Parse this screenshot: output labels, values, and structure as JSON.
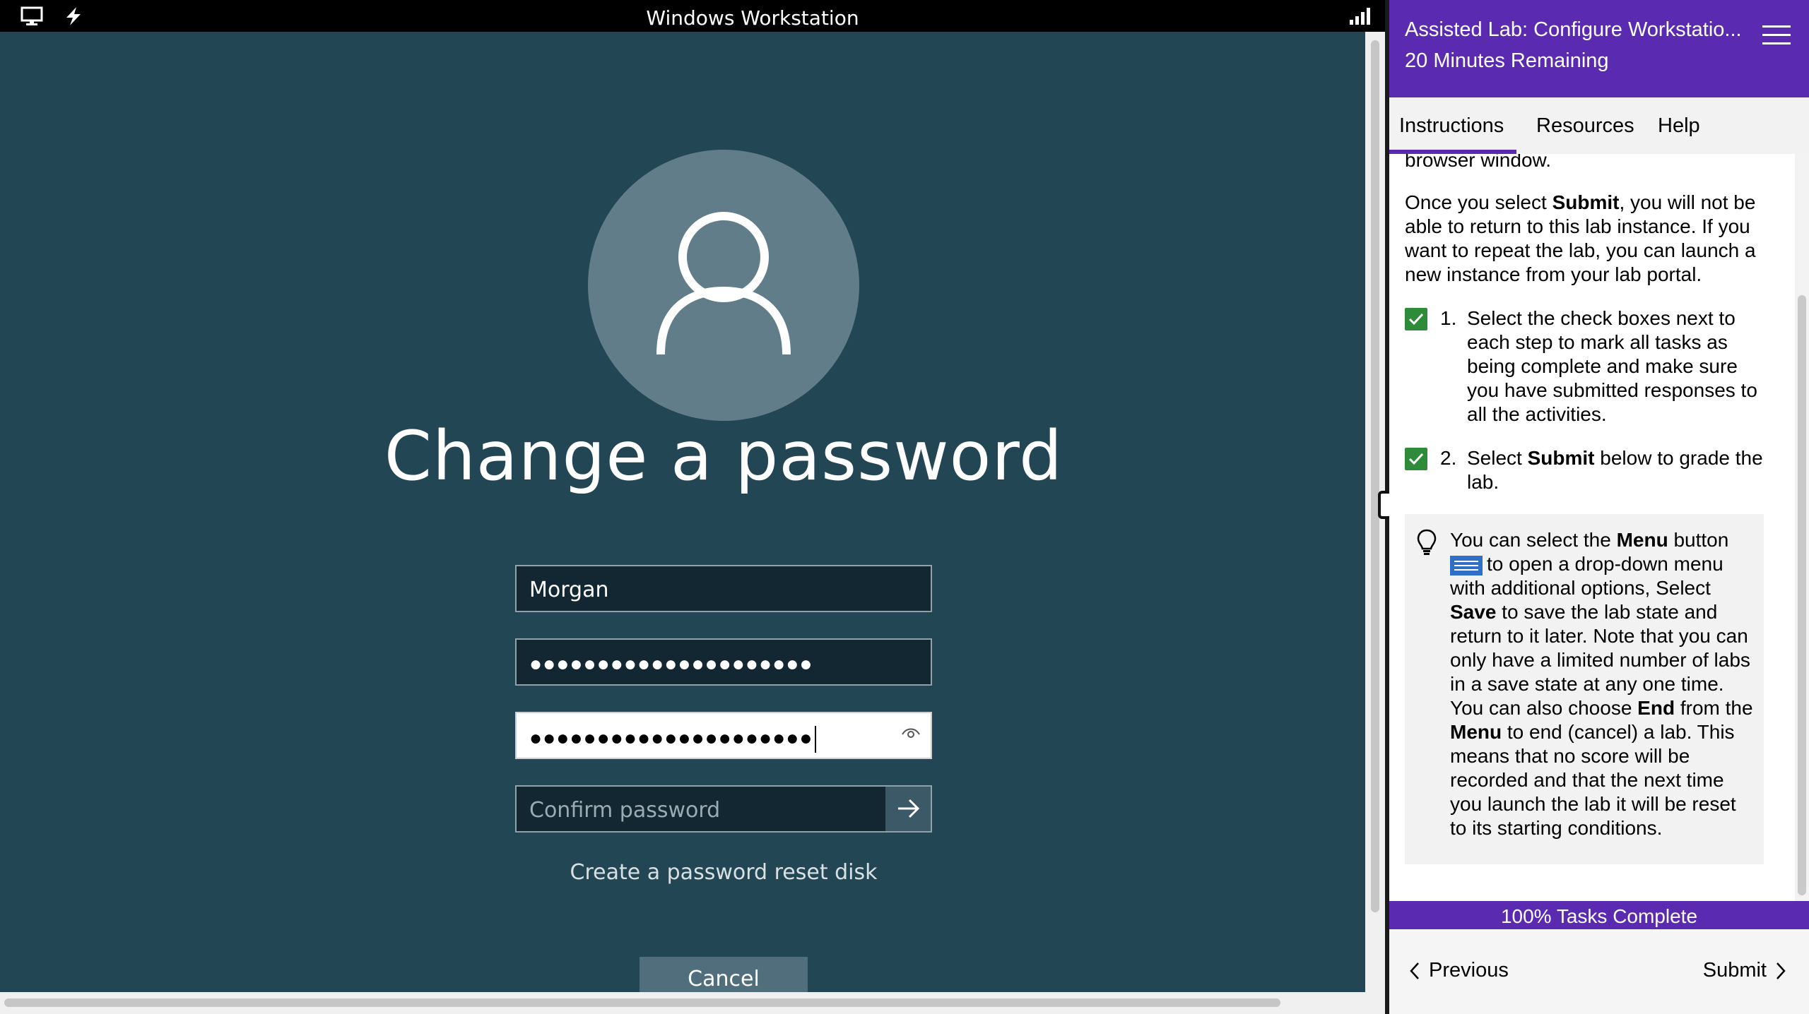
{
  "vm": {
    "title": "Windows Workstation",
    "icons": [
      "monitor-icon",
      "lightning-icon",
      "signal-icon"
    ]
  },
  "login": {
    "title": "Change a password",
    "username": "Morgan",
    "old_password_mask": "●●●●●●●●●●●●●●●●●●●●●",
    "new_password_mask": "●●●●●●●●●●●●●●●●●●●●●",
    "confirm_placeholder": "Confirm password",
    "reset_link": "Create a password reset disk",
    "cancel_label": "Cancel"
  },
  "panel": {
    "title": "Assisted Lab: Configure Workstatio...",
    "time_remaining": "20 Minutes Remaining",
    "tabs": [
      {
        "label": "Instructions"
      },
      {
        "label": "Resources"
      },
      {
        "label": "Help"
      }
    ],
    "intro_cut": "browser window.",
    "submit_note": {
      "pre": "Once you select ",
      "bold": "Submit",
      "post": ", you will not be able to return to this lab instance. If you want to repeat the lab, you can launch a new instance from your lab portal."
    },
    "steps": [
      {
        "num": "1.",
        "text": "Select the check boxes next to each step to mark all tasks as being complete and make sure you have submitted responses to all the activities.",
        "checked": true
      },
      {
        "num": "2.",
        "pre": "Select ",
        "bold": "Submit",
        "post": " below to grade the lab.",
        "checked": true
      }
    ],
    "tip": {
      "t1": "You can select the ",
      "b1": "Menu",
      "t2": " button",
      "t3": "to open a drop-down menu with additional options, Select ",
      "b2": "Save",
      "t4": " to save the lab state and return to it later. Note that you can only have a limited number of labs in a save state at any one time. You can also choose ",
      "b3": "End",
      "t5": " from the ",
      "b4": "Menu",
      "t6": " to end (cancel) a lab. This means that no score will be recorded and that the next time you launch the lab it will be reset to its starting conditions."
    },
    "progress": "100% Tasks Complete",
    "progress_value": 100,
    "prev_label": "Previous",
    "next_label": "Submit"
  },
  "colors": {
    "accent": "#5a2bb0",
    "desktop": "#234655",
    "check": "#2e8b3a"
  }
}
